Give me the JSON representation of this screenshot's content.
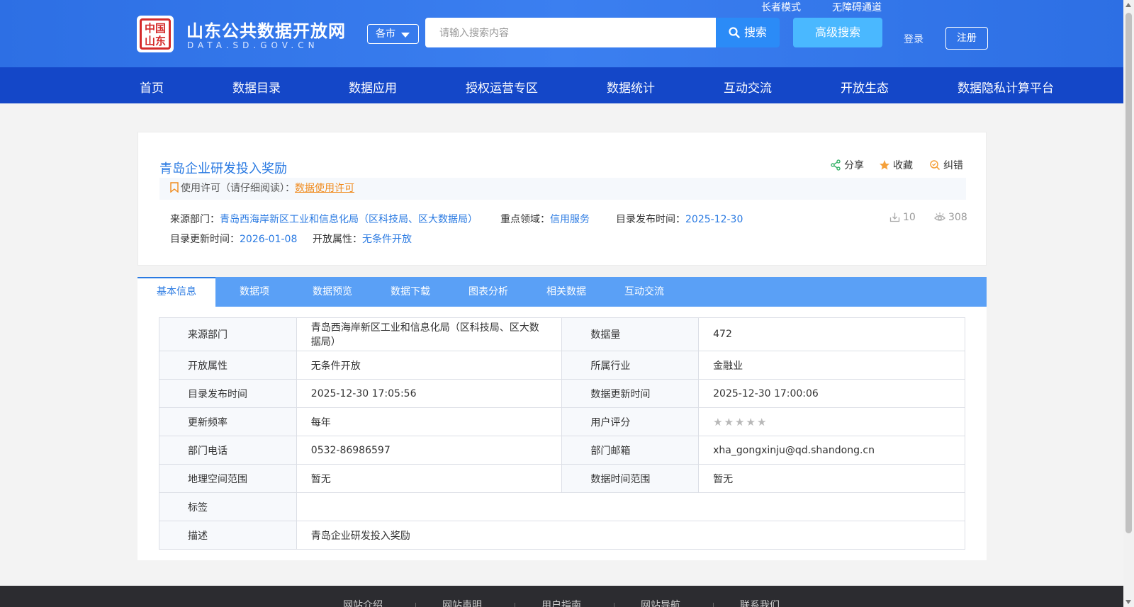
{
  "header": {
    "logo_seal": "中国山东",
    "site_title": "山东公共数据开放网",
    "site_domain": "DATA.SD.GOV.CN",
    "city_select": "各市",
    "search_placeholder": "请输入搜索内容",
    "search_label": "搜索",
    "advanced_search": "高级搜索",
    "elder_mode": "长者模式",
    "accessibility": "无障碍通道",
    "login": "登录",
    "register": "注册"
  },
  "nav": [
    "首页",
    "数据目录",
    "数据应用",
    "授权运营专区",
    "数据统计",
    "互动交流",
    "开放生态",
    "数据隐私计算平台"
  ],
  "dataset": {
    "title": "青岛企业研发投入奖励",
    "share": "分享",
    "favorite": "收藏",
    "report_error": "纠错",
    "license_label": "使用许可（请仔细阅读）：",
    "license_link": "数据使用许可",
    "source_label": "来源部门：",
    "source_value": "青岛西海岸新区工业和信息化局（区科技局、区大数据局）",
    "domain_label": "重点领域：",
    "domain_value": "信用服务",
    "publish_label": "目录发布时间：",
    "publish_value": "2025-12-30",
    "update_label": "目录更新时间：",
    "update_value": "2026-01-08",
    "open_label": "开放属性：",
    "open_value": "无条件开放",
    "downloads": "10",
    "views": "308"
  },
  "tabs": [
    "基本信息",
    "数据项",
    "数据预览",
    "数据下载",
    "图表分析",
    "相关数据",
    "互动交流"
  ],
  "details": {
    "source_dept_label": "来源部门",
    "source_dept": "青岛西海岸新区工业和信息化局（区科技局、区大数据局）",
    "volume_label": "数据量",
    "volume": "472",
    "open_attr_label": "开放属性",
    "open_attr": "无条件开放",
    "industry_label": "所属行业",
    "industry": "金融业",
    "catalog_publish_label": "目录发布时间",
    "catalog_publish": "2025-12-30 17:05:56",
    "data_update_label": "数据更新时间",
    "data_update": "2025-12-30 17:00:06",
    "frequency_label": "更新频率",
    "frequency": "每年",
    "rating_label": "用户评分",
    "rating_stars": 0,
    "phone_label": "部门电话",
    "phone": "0532-86986597",
    "email_label": "部门邮箱",
    "email": "xha_gongxinju@qd.shandong.cn",
    "geo_label": "地理空间范围",
    "geo": "暂无",
    "time_range_label": "数据时间范围",
    "time_range": "暂无",
    "tags_label": "标签",
    "tags": "",
    "desc_label": "描述",
    "desc": "青岛企业研发投入奖励"
  },
  "footer": [
    "网站介绍",
    "网站声明",
    "用户指南",
    "网站导航",
    "联系我们"
  ],
  "colors": {
    "header_blue": "#2d6fe4",
    "nav_blue": "#1447c8",
    "link_blue": "#2a7ae2",
    "tab_blue": "#5aa0f6",
    "license_orange": "#f08a1c"
  }
}
